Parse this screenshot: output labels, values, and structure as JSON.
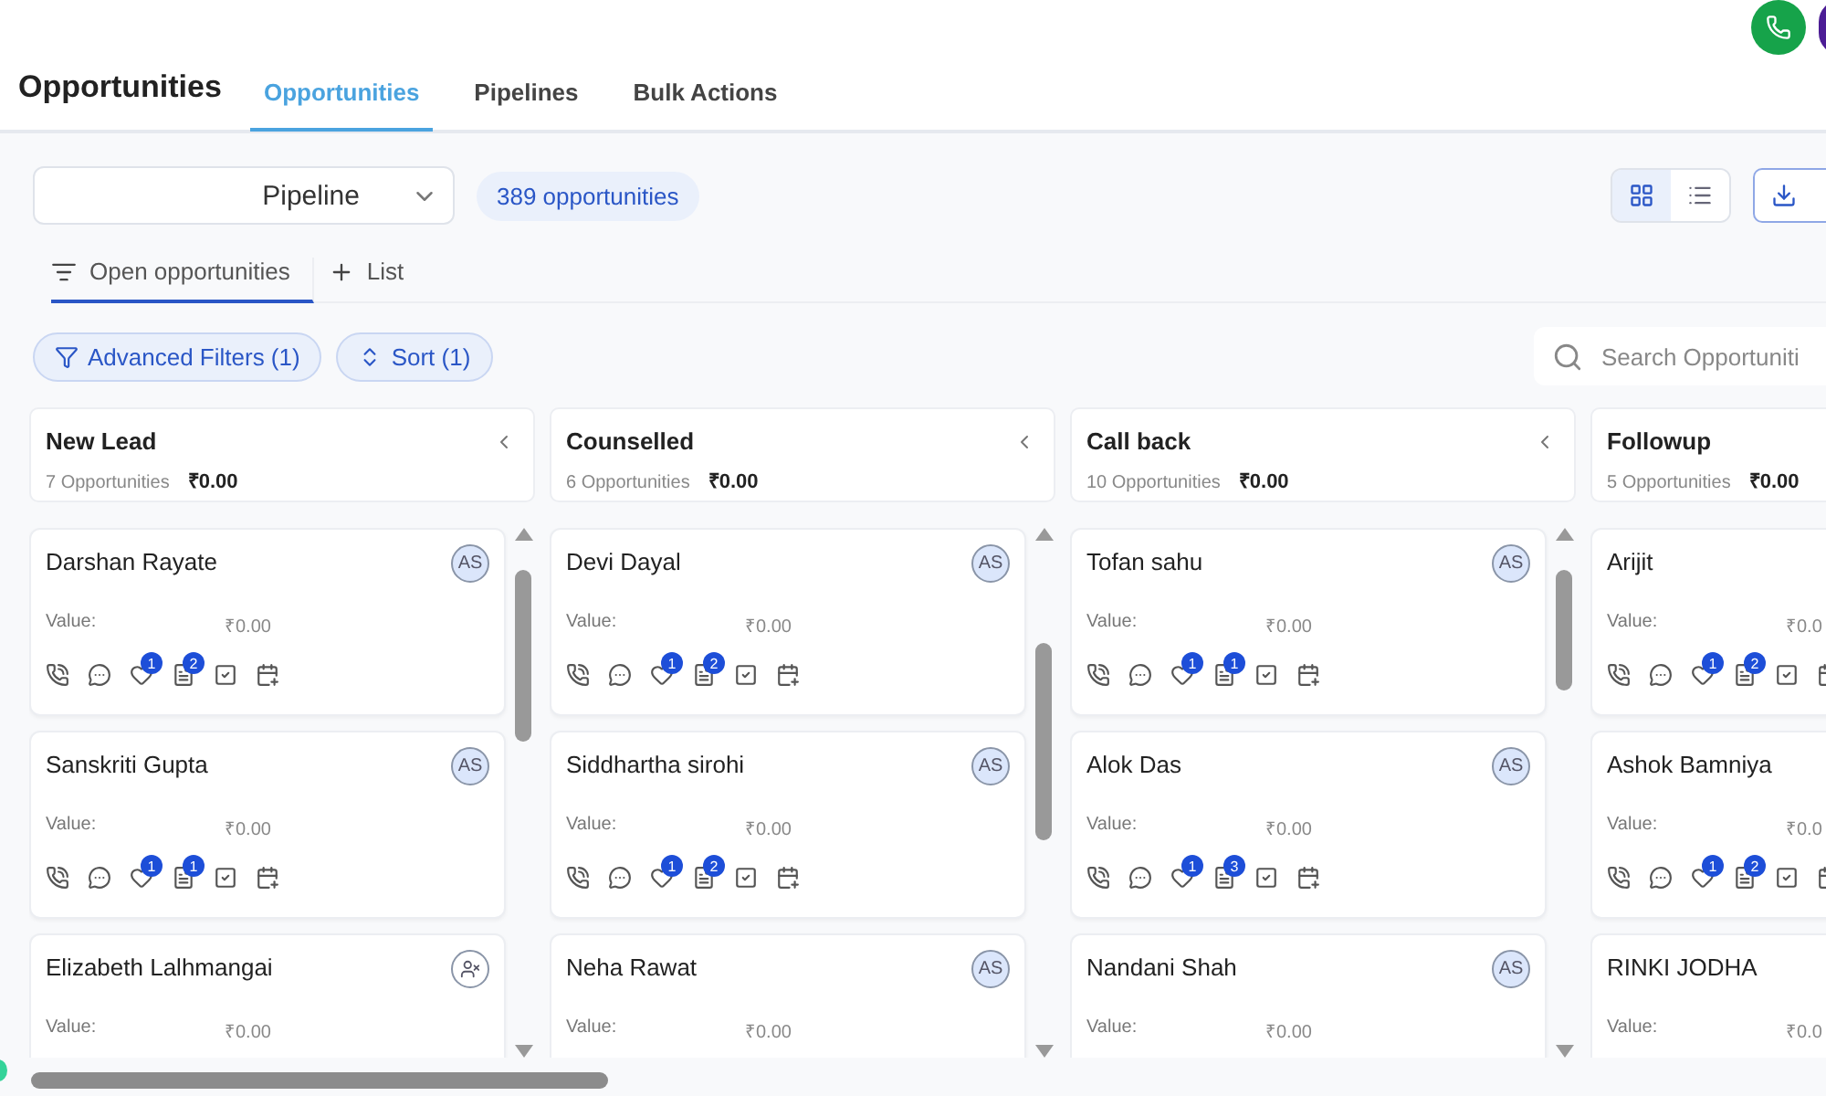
{
  "header": {
    "title": "Opportunities",
    "tabs": [
      {
        "label": "Opportunities",
        "selected": true
      },
      {
        "label": "Pipelines",
        "selected": false
      },
      {
        "label": "Bulk Actions",
        "selected": false
      }
    ]
  },
  "toolbar": {
    "pipeline": "Pipeline",
    "count": "389 opportunities",
    "views": [
      {
        "kind": "grid",
        "selected": true
      },
      {
        "kind": "list",
        "selected": false
      }
    ]
  },
  "list_tabs": [
    {
      "label": "Open opportunities",
      "kind": "view",
      "selected": true
    },
    {
      "label": "List",
      "kind": "add",
      "selected": false
    }
  ],
  "filters": [
    {
      "label": "Advanced Filters (1)",
      "kind": "filter"
    },
    {
      "label": "Sort (1)",
      "kind": "sort"
    }
  ],
  "search": {
    "placeholder": "Search Opportuniti"
  },
  "columns": [
    {
      "title": "New Lead",
      "count": "7 Opportunities",
      "total": "₹0.00",
      "cards": [
        {
          "name": "Darshan Rayate",
          "value_label": "Value:",
          "value": "₹0.00",
          "assignee": {
            "kind": "initials",
            "text": "AS"
          },
          "likes": "1",
          "notes": "2"
        },
        {
          "name": "Sanskriti Gupta",
          "value_label": "Value:",
          "value": "₹0.00",
          "assignee": {
            "kind": "initials",
            "text": "AS"
          },
          "likes": "1",
          "notes": "1"
        },
        {
          "name": "Elizabeth Lalhmangai",
          "value_label": "Value:",
          "value": "₹0.00",
          "assignee": {
            "kind": "unassigned"
          }
        }
      ]
    },
    {
      "title": "Counselled",
      "count": "6 Opportunities",
      "total": "₹0.00",
      "cards": [
        {
          "name": "Devi Dayal",
          "value_label": "Value:",
          "value": "₹0.00",
          "assignee": {
            "kind": "initials",
            "text": "AS"
          },
          "likes": "1",
          "notes": "2"
        },
        {
          "name": "Siddhartha sirohi",
          "value_label": "Value:",
          "value": "₹0.00",
          "assignee": {
            "kind": "initials",
            "text": "AS"
          },
          "likes": "1",
          "notes": "2"
        },
        {
          "name": "Neha Rawat",
          "value_label": "Value:",
          "value": "₹0.00",
          "assignee": {
            "kind": "initials",
            "text": "AS"
          }
        }
      ]
    },
    {
      "title": "Call back",
      "count": "10 Opportunities",
      "total": "₹0.00",
      "cards": [
        {
          "name": "Tofan sahu",
          "value_label": "Value:",
          "value": "₹0.00",
          "assignee": {
            "kind": "initials",
            "text": "AS"
          },
          "likes": "1",
          "notes": "1"
        },
        {
          "name": "Alok Das",
          "value_label": "Value:",
          "value": "₹0.00",
          "assignee": {
            "kind": "initials",
            "text": "AS"
          },
          "likes": "1",
          "notes": "3"
        },
        {
          "name": "Nandani Shah",
          "value_label": "Value:",
          "value": "₹0.00",
          "assignee": {
            "kind": "initials",
            "text": "AS"
          }
        }
      ]
    },
    {
      "title": "Followup",
      "count": "5 Opportunities",
      "total": "₹0.00",
      "cards": [
        {
          "name": "Arijit",
          "value_label": "Value:",
          "value": "₹0.0",
          "likes": "1",
          "notes": "2"
        },
        {
          "name": "Ashok Bamniya",
          "value_label": "Value:",
          "value": "₹0.0",
          "likes": "1",
          "notes": "2"
        },
        {
          "name": "RINKI JODHA",
          "value_label": "Value:",
          "value": "₹0.0"
        }
      ]
    }
  ]
}
